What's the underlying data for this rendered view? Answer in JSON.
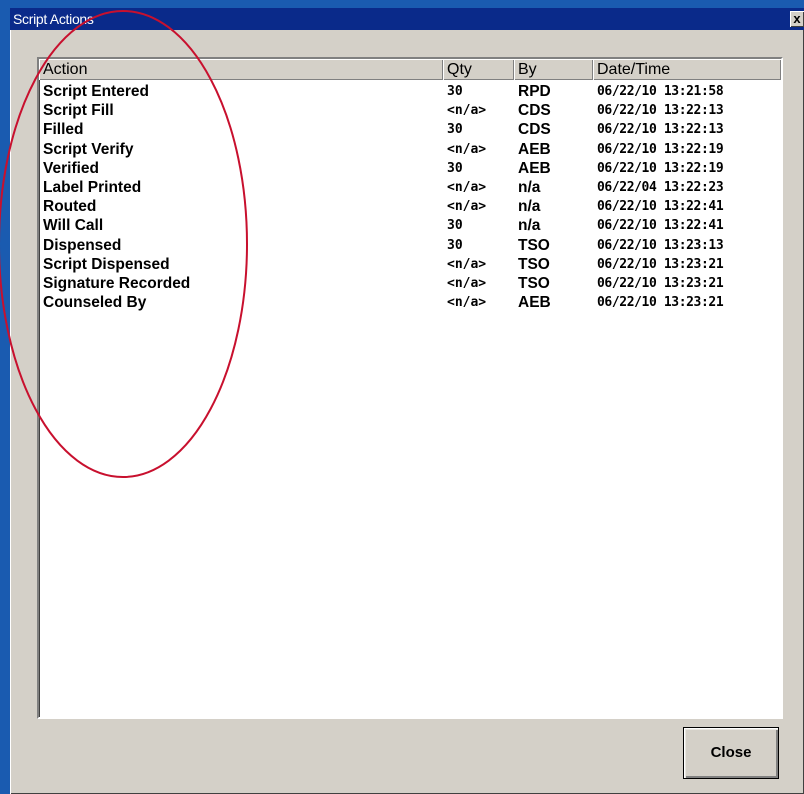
{
  "window": {
    "title": "Script Actions",
    "close_glyph": "x"
  },
  "list": {
    "columns": {
      "action": "Action",
      "qty": "Qty",
      "by": "By",
      "datetime": "Date/Time"
    },
    "rows": [
      {
        "action": "Script Entered",
        "qty": "30",
        "by": "RPD",
        "datetime": "06/22/10 13:21:58"
      },
      {
        "action": "Script Fill",
        "qty": "<n/a>",
        "by": "CDS",
        "datetime": "06/22/10 13:22:13"
      },
      {
        "action": "Filled",
        "qty": "30",
        "by": "CDS",
        "datetime": "06/22/10 13:22:13"
      },
      {
        "action": "Script Verify",
        "qty": "<n/a>",
        "by": "AEB",
        "datetime": "06/22/10 13:22:19"
      },
      {
        "action": "Verified",
        "qty": "30",
        "by": "AEB",
        "datetime": "06/22/10 13:22:19"
      },
      {
        "action": "Label Printed",
        "qty": "<n/a>",
        "by": "n/a",
        "datetime": "06/22/04 13:22:23"
      },
      {
        "action": "Routed",
        "qty": "<n/a>",
        "by": "n/a",
        "datetime": "06/22/10 13:22:41"
      },
      {
        "action": "Will Call",
        "qty": "30",
        "by": "n/a",
        "datetime": "06/22/10 13:22:41"
      },
      {
        "action": "Dispensed",
        "qty": "30",
        "by": "TSO",
        "datetime": "06/22/10 13:23:13"
      },
      {
        "action": "Script Dispensed",
        "qty": "<n/a>",
        "by": "TSO",
        "datetime": "06/22/10 13:23:21"
      },
      {
        "action": "Signature Recorded",
        "qty": "<n/a>",
        "by": "TSO",
        "datetime": "06/22/10 13:23:21"
      },
      {
        "action": "Counseled By",
        "qty": "<n/a>",
        "by": "AEB",
        "datetime": "06/22/10 13:23:21"
      }
    ]
  },
  "buttons": {
    "close_label": "Close"
  },
  "colors": {
    "title_bar": "#0a2a8a",
    "background": "#1a5bb0",
    "annotation_ellipse": "#c8102e"
  }
}
